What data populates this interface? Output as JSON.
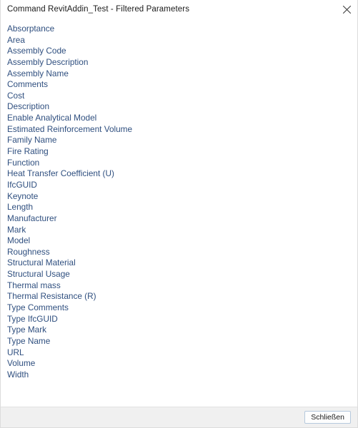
{
  "window": {
    "title": "Command RevitAddin_Test - Filtered Parameters",
    "close_icon": "close-icon"
  },
  "colors": {
    "list_text": "#2f4f7f",
    "title_text": "#1a1a1a",
    "footer_bg": "#f0f0f0",
    "button_border": "#b6c9dd",
    "window_bg": "#ffffff"
  },
  "list": {
    "items": [
      "Absorptance",
      "Area",
      "Assembly Code",
      "Assembly Description",
      "Assembly Name",
      "Comments",
      "Cost",
      "Description",
      "Enable Analytical Model",
      "Estimated Reinforcement Volume",
      "Family Name",
      "Fire Rating",
      "Function",
      "Heat Transfer Coefficient (U)",
      "IfcGUID",
      "Keynote",
      "Length",
      "Manufacturer",
      "Mark",
      "Model",
      "Roughness",
      "Structural Material",
      "Structural Usage",
      "Thermal mass",
      "Thermal Resistance (R)",
      "Type Comments",
      "Type IfcGUID",
      "Type Mark",
      "Type Name",
      "URL",
      "Volume",
      "Width"
    ]
  },
  "footer": {
    "close_label": "Schließen"
  }
}
